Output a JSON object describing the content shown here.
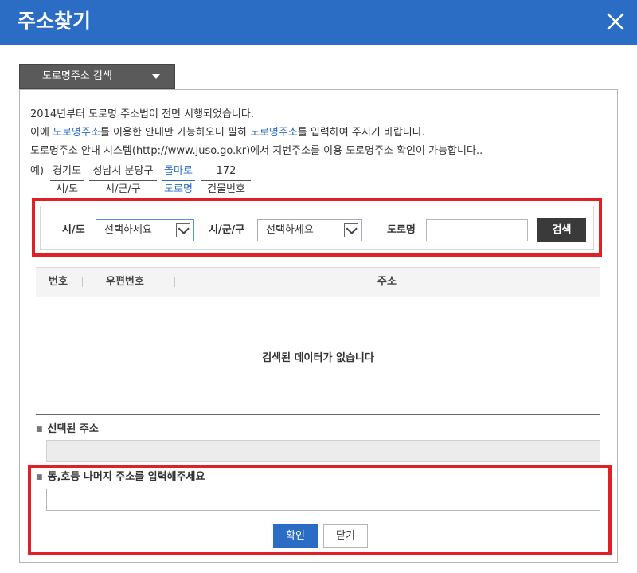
{
  "window": {
    "title": "주소찾기",
    "close_icon": "close-icon"
  },
  "tab": {
    "label": "도로명주소 검색",
    "icon": "caret-down-icon"
  },
  "intro": {
    "line1": "2014년부터 도로명 주소법이 전면 시행되었습니다.",
    "line2_a": "이에 ",
    "line2_b": "도로명주소",
    "line2_c": "를 이용한 안내만 가능하오니 필히 ",
    "line2_d": "도로명주소",
    "line2_e": "를 입력하여 주시기 바랍니다.",
    "line3_a": "도로명주소 안내 시스템",
    "line3_b": "(http://www.juso.go.kr)",
    "line3_c": "에서 지번주소를 이용 도로명주소 확인이 가능합니다.."
  },
  "example": {
    "prefix": "예)",
    "parts": [
      {
        "value": "경기도",
        "key": "시/도"
      },
      {
        "value": "성남시 분당구",
        "key": "시/군/구"
      },
      {
        "value": "돌마로",
        "key": "도로명"
      },
      {
        "value": "172",
        "key": "건물번호"
      }
    ]
  },
  "search": {
    "sido_label": "시/도",
    "sido_value": "선택하세요",
    "sigungu_label": "시/군/구",
    "sigungu_value": "선택하세요",
    "road_label": "도로명",
    "road_value": "",
    "button": "검색"
  },
  "table": {
    "columns": [
      "번호",
      "우편번호",
      "주소"
    ],
    "empty_message": "검색된 데이터가 없습니다"
  },
  "selected": {
    "label": "선택된 주소",
    "value": ""
  },
  "detail": {
    "label": "동,호등 나머지 주소를 입력해주세요",
    "value": ""
  },
  "buttons": {
    "confirm": "확인",
    "close": "닫기"
  },
  "colors": {
    "title_bar": "#2b6cc4",
    "highlight": "#e01f26",
    "link": "#2b6cc4",
    "search_button": "#3a3a3a"
  }
}
